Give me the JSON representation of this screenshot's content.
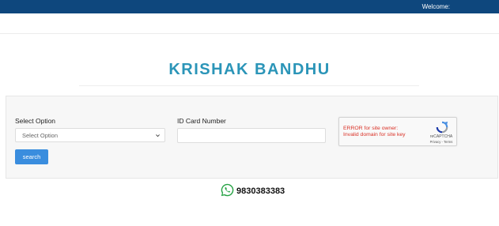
{
  "header": {
    "welcome": "Welcome:"
  },
  "page": {
    "title": "KRISHAK BANDHU"
  },
  "form": {
    "select_label": "Select Option",
    "select_value": "Select Option",
    "id_label": "ID Card Number",
    "id_value": "",
    "search_label": "search"
  },
  "captcha": {
    "error_line1": "ERROR for site owner:",
    "error_line2": "Invalid domain for site key",
    "brand": "reCAPTCHA",
    "links": "Privacy - Terms"
  },
  "contact": {
    "phone": "9830383383",
    "icon": "whatsapp-icon"
  },
  "colors": {
    "topbar": "#0e477d",
    "title": "#2b95b8",
    "button": "#3a8dde",
    "error": "#d93025",
    "whatsapp": "#25a244"
  }
}
